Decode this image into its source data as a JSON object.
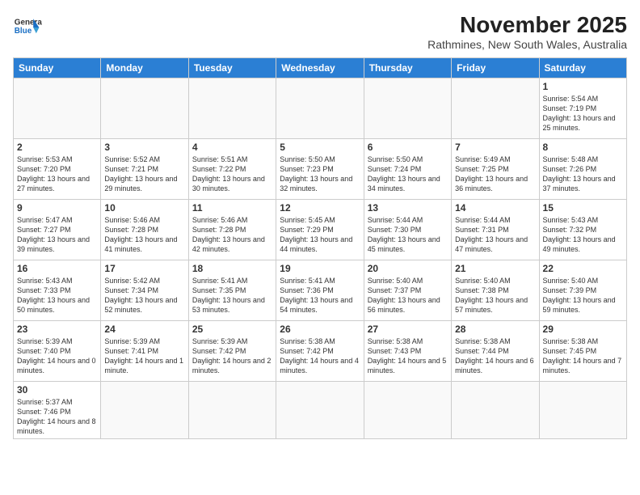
{
  "header": {
    "logo_general": "General",
    "logo_blue": "Blue",
    "month_title": "November 2025",
    "subtitle": "Rathmines, New South Wales, Australia"
  },
  "days_of_week": [
    "Sunday",
    "Monday",
    "Tuesday",
    "Wednesday",
    "Thursday",
    "Friday",
    "Saturday"
  ],
  "weeks": [
    [
      {
        "day": "",
        "empty": true
      },
      {
        "day": "",
        "empty": true
      },
      {
        "day": "",
        "empty": true
      },
      {
        "day": "",
        "empty": true
      },
      {
        "day": "",
        "empty": true
      },
      {
        "day": "",
        "empty": true
      },
      {
        "day": "1",
        "sunrise": "5:54 AM",
        "sunset": "7:19 PM",
        "daylight": "13 hours and 25 minutes."
      }
    ],
    [
      {
        "day": "2",
        "sunrise": "5:53 AM",
        "sunset": "7:20 PM",
        "daylight": "13 hours and 27 minutes."
      },
      {
        "day": "3",
        "sunrise": "5:52 AM",
        "sunset": "7:21 PM",
        "daylight": "13 hours and 29 minutes."
      },
      {
        "day": "4",
        "sunrise": "5:51 AM",
        "sunset": "7:22 PM",
        "daylight": "13 hours and 30 minutes."
      },
      {
        "day": "5",
        "sunrise": "5:50 AM",
        "sunset": "7:23 PM",
        "daylight": "13 hours and 32 minutes."
      },
      {
        "day": "6",
        "sunrise": "5:50 AM",
        "sunset": "7:24 PM",
        "daylight": "13 hours and 34 minutes."
      },
      {
        "day": "7",
        "sunrise": "5:49 AM",
        "sunset": "7:25 PM",
        "daylight": "13 hours and 36 minutes."
      },
      {
        "day": "8",
        "sunrise": "5:48 AM",
        "sunset": "7:26 PM",
        "daylight": "13 hours and 37 minutes."
      }
    ],
    [
      {
        "day": "9",
        "sunrise": "5:47 AM",
        "sunset": "7:27 PM",
        "daylight": "13 hours and 39 minutes."
      },
      {
        "day": "10",
        "sunrise": "5:46 AM",
        "sunset": "7:28 PM",
        "daylight": "13 hours and 41 minutes."
      },
      {
        "day": "11",
        "sunrise": "5:46 AM",
        "sunset": "7:28 PM",
        "daylight": "13 hours and 42 minutes."
      },
      {
        "day": "12",
        "sunrise": "5:45 AM",
        "sunset": "7:29 PM",
        "daylight": "13 hours and 44 minutes."
      },
      {
        "day": "13",
        "sunrise": "5:44 AM",
        "sunset": "7:30 PM",
        "daylight": "13 hours and 45 minutes."
      },
      {
        "day": "14",
        "sunrise": "5:44 AM",
        "sunset": "7:31 PM",
        "daylight": "13 hours and 47 minutes."
      },
      {
        "day": "15",
        "sunrise": "5:43 AM",
        "sunset": "7:32 PM",
        "daylight": "13 hours and 49 minutes."
      }
    ],
    [
      {
        "day": "16",
        "sunrise": "5:43 AM",
        "sunset": "7:33 PM",
        "daylight": "13 hours and 50 minutes."
      },
      {
        "day": "17",
        "sunrise": "5:42 AM",
        "sunset": "7:34 PM",
        "daylight": "13 hours and 52 minutes."
      },
      {
        "day": "18",
        "sunrise": "5:41 AM",
        "sunset": "7:35 PM",
        "daylight": "13 hours and 53 minutes."
      },
      {
        "day": "19",
        "sunrise": "5:41 AM",
        "sunset": "7:36 PM",
        "daylight": "13 hours and 54 minutes."
      },
      {
        "day": "20",
        "sunrise": "5:40 AM",
        "sunset": "7:37 PM",
        "daylight": "13 hours and 56 minutes."
      },
      {
        "day": "21",
        "sunrise": "5:40 AM",
        "sunset": "7:38 PM",
        "daylight": "13 hours and 57 minutes."
      },
      {
        "day": "22",
        "sunrise": "5:40 AM",
        "sunset": "7:39 PM",
        "daylight": "13 hours and 59 minutes."
      }
    ],
    [
      {
        "day": "23",
        "sunrise": "5:39 AM",
        "sunset": "7:40 PM",
        "daylight": "14 hours and 0 minutes."
      },
      {
        "day": "24",
        "sunrise": "5:39 AM",
        "sunset": "7:41 PM",
        "daylight": "14 hours and 1 minute."
      },
      {
        "day": "25",
        "sunrise": "5:39 AM",
        "sunset": "7:42 PM",
        "daylight": "14 hours and 2 minutes."
      },
      {
        "day": "26",
        "sunrise": "5:38 AM",
        "sunset": "7:42 PM",
        "daylight": "14 hours and 4 minutes."
      },
      {
        "day": "27",
        "sunrise": "5:38 AM",
        "sunset": "7:43 PM",
        "daylight": "14 hours and 5 minutes."
      },
      {
        "day": "28",
        "sunrise": "5:38 AM",
        "sunset": "7:44 PM",
        "daylight": "14 hours and 6 minutes."
      },
      {
        "day": "29",
        "sunrise": "5:38 AM",
        "sunset": "7:45 PM",
        "daylight": "14 hours and 7 minutes."
      }
    ],
    [
      {
        "day": "30",
        "sunrise": "5:37 AM",
        "sunset": "7:46 PM",
        "daylight": "14 hours and 8 minutes."
      },
      {
        "day": "",
        "empty": true
      },
      {
        "day": "",
        "empty": true
      },
      {
        "day": "",
        "empty": true
      },
      {
        "day": "",
        "empty": true
      },
      {
        "day": "",
        "empty": true
      },
      {
        "day": "",
        "empty": true
      }
    ]
  ]
}
